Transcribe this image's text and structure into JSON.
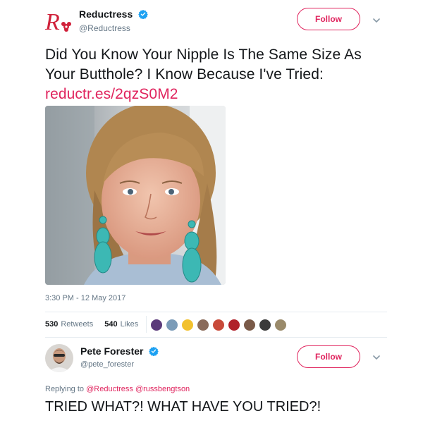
{
  "tweet1": {
    "author_name": "Reductress",
    "handle": "@Reductress",
    "follow_label": "Follow",
    "text": "Did You Know Your Nipple Is The Same Size As Your Butthole? I Know Because I've Tried:",
    "link": "reductr.es/2qzS0M2",
    "timestamp": "3:30 PM - 12 May 2017",
    "retweets_count": "530",
    "retweets_label": "Retweets",
    "likes_count": "540",
    "likes_label": "Likes",
    "liker_avatars": [
      {
        "color": "#5b3a7a"
      },
      {
        "color": "#7a9bb8"
      },
      {
        "color": "#f2c12e"
      },
      {
        "color": "#8a6b5a"
      },
      {
        "color": "#c84a3a"
      },
      {
        "color": "#b0202a"
      },
      {
        "color": "#7a5a48"
      },
      {
        "color": "#3a3a3a"
      },
      {
        "color": "#9a8a6a"
      }
    ]
  },
  "tweet2": {
    "author_name": "Pete Forester",
    "handle": "@pete_forester",
    "follow_label": "Follow",
    "replying_prefix": "Replying to",
    "replying_mentions": "@Reductress @russbengtson",
    "text": "TRIED WHAT?! WHAT HAVE YOU TRIED?!"
  },
  "icons": {
    "verified": "verified-badge-icon",
    "chevron": "chevron-down-icon",
    "logo": "reductress-logo"
  },
  "colors": {
    "accent": "#e0245e",
    "verified_blue": "#1da1f2",
    "secondary_text": "#657786",
    "divider": "#e6ecf0"
  }
}
